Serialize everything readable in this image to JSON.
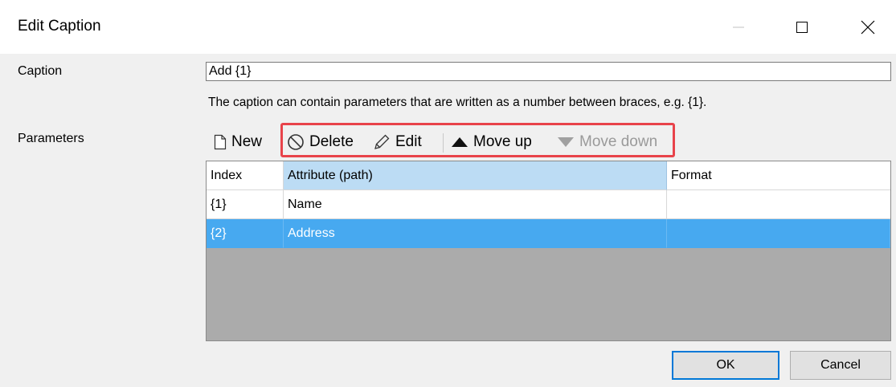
{
  "window": {
    "title": "Edit Caption"
  },
  "caption": {
    "label": "Caption",
    "value": "Add {1}",
    "hint": "The caption can contain parameters that are written as a number between braces, e.g. {1}."
  },
  "parameters": {
    "label": "Parameters",
    "toolbar": {
      "new_label": "New",
      "delete_label": "Delete",
      "edit_label": "Edit",
      "move_up_label": "Move up",
      "move_down_label": "Move down"
    },
    "columns": [
      "Index",
      "Attribute (path)",
      "Format"
    ],
    "rows": [
      {
        "index": "{1}",
        "attribute": "Name",
        "format": ""
      },
      {
        "index": "{2}",
        "attribute": "Address",
        "format": ""
      }
    ],
    "selected_row": 1
  },
  "buttons": {
    "ok_label": "OK",
    "cancel_label": "Cancel"
  },
  "colors": {
    "selection": "#47a9f0",
    "highlight_border": "#e8434a",
    "grid_empty": "#ababab"
  }
}
